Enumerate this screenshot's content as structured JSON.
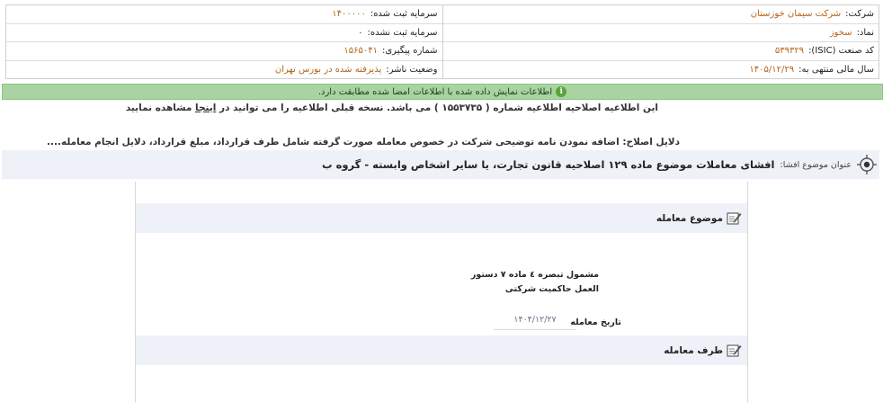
{
  "info": {
    "right": [
      {
        "label": "شرکت:",
        "value": "شرکت سیمان خوزستان"
      },
      {
        "label": "نماد:",
        "value": "سخوز"
      },
      {
        "label": "کد صنعت (ISIC):",
        "value": "۵۳۹۳۲۹"
      },
      {
        "label": "سال مالی منتهی به:",
        "value": "۱۴۰۵/۱۲/۲۹"
      }
    ],
    "left": [
      {
        "label": "سرمایه ثبت شده:",
        "value": "۱۴۰۰۰۰۰"
      },
      {
        "label": "سرمایه ثبت نشده:",
        "value": "۰"
      },
      {
        "label": "شماره پیگیری:",
        "value": "۱۵۶۵۰۴۱"
      },
      {
        "label": "وضعیت ناشر:",
        "value": "پذیرفته شده در بورس تهران"
      }
    ]
  },
  "notice": {
    "text": "اطلاعات نمایش داده شده با اطلاعات امضا شده مطابقت دارد.",
    "icon": "info-icon"
  },
  "correction": {
    "line_start": "این اطلاعیه اصلاحیه اطلاعیه شماره ( ۱۵۵۳۷۳۵ ) می باشد. نسخه قبلی اطلاعیه را می توانید در ",
    "link": "اینجا",
    "line_end": " مشاهده نمایید",
    "reasons": "دلایل اصلاح: اضافه نمودن نامه توضیحی شرکت در خصوص معامله صورت گرفته شامل طرف قرارداد، مبلغ قرارداد، دلایل انجام معامله...."
  },
  "subject": {
    "label": "عنوان موضوع افشا:",
    "value": "افشای معاملات موضوع ماده ۱۲۹ اصلاحیه قانون تجارت، یا سایر اشخاص وابسته - گروه ب"
  },
  "sections": {
    "deal_subject": {
      "title": "موضوع معامله"
    },
    "deal_party": {
      "title": "طرف معامله"
    }
  },
  "deal": {
    "subject_text": "مشمول تبصره ٤ ماده ٧ دستور العمل حاکمیت شرکتی",
    "date_label": "تاریخ معامله",
    "date_value": "۱۴۰۴/۱۲/۲۷"
  },
  "colors": {
    "notice_bg": "#a9d4a1",
    "section_bg": "#eef2f8",
    "value_orange": "#b5651d"
  }
}
